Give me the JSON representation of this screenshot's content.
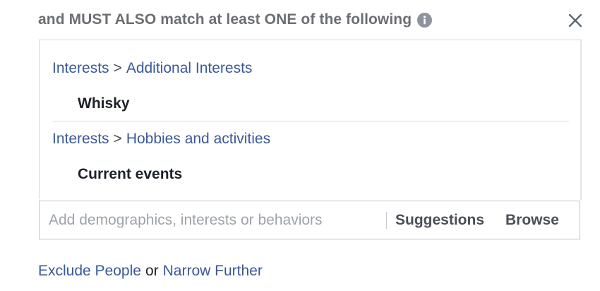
{
  "header": {
    "title": "and MUST ALSO match at least ONE of the following",
    "info_icon": "info-circle-icon",
    "close_icon": "close-x-icon"
  },
  "targeting": {
    "groups": [
      {
        "category": "Interests",
        "separator": ">",
        "subcategory": "Additional Interests",
        "items": [
          "Whisky"
        ]
      },
      {
        "category": "Interests",
        "separator": ">",
        "subcategory": "Hobbies and activities",
        "items": [
          "Current events"
        ]
      }
    ]
  },
  "search": {
    "placeholder": "Add demographics, interests or behaviors",
    "value": "",
    "suggestions_label": "Suggestions",
    "browse_label": "Browse"
  },
  "footer": {
    "exclude_label": "Exclude People",
    "or_label": "or",
    "narrow_label": "Narrow Further"
  },
  "colors": {
    "link": "#3b5998",
    "header_text": "#6b6e73",
    "item_text": "#1d2129",
    "border": "#d3d6db"
  }
}
